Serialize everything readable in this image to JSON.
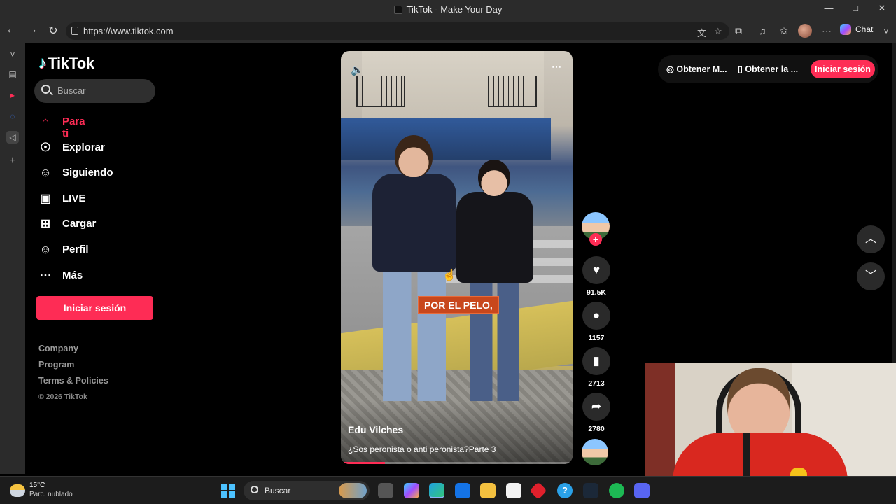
{
  "window": {
    "title": "TikTok - Make Your Day",
    "minimize": "—",
    "maximize": "□",
    "close": "✕"
  },
  "browser": {
    "url": "https://www.tiktok.com",
    "back": "←",
    "forward": "→",
    "reload": "↻",
    "chat_label": "Chat",
    "translate_icon": "文",
    "star_icon": "☆",
    "extensions_icon": "⧉",
    "media_icon": "♫",
    "favorites_icon": "✩",
    "more_icon": "⋯",
    "sidebar_collapse": "˅"
  },
  "edge_sidebar": {
    "items": [
      "˅",
      "▤",
      "▸",
      "◌",
      "◁",
      "+"
    ]
  },
  "tiktok": {
    "logo": "TikTok",
    "search_placeholder": "Buscar",
    "nav": [
      {
        "label": "Para ti",
        "icon": "home-icon",
        "glyph": "⌂",
        "active": true
      },
      {
        "label": "Explorar",
        "icon": "compass-icon",
        "glyph": "☉",
        "active": false
      },
      {
        "label": "Siguiendo",
        "icon": "following-icon",
        "glyph": "☺",
        "active": false
      },
      {
        "label": "LIVE",
        "icon": "live-icon",
        "glyph": "▣",
        "active": false
      },
      {
        "label": "Cargar",
        "icon": "upload-icon",
        "glyph": "⊞",
        "active": false
      },
      {
        "label": "Perfil",
        "icon": "profile-icon",
        "glyph": "☺",
        "active": false
      },
      {
        "label": "Más",
        "icon": "more-icon",
        "glyph": "⋯",
        "active": false
      }
    ],
    "login_button": "Iniciar sesión",
    "footer": [
      "Company",
      "Program",
      "Terms & Policies"
    ],
    "copyright": "© 2026 TikTok",
    "video": {
      "overlay_caption": "POR EL PELO,",
      "author": "Edu Vilches",
      "description": "¿Sos peronista o anti peronista?Parte 3",
      "progress": 0.19
    },
    "actions": {
      "likes": "91.5K",
      "comments": "1157",
      "saves": "2713",
      "shares": "2780"
    },
    "top_right": {
      "get_app_1": "Obtener M...",
      "get_app_2": "Obtener la ...",
      "login": "Iniciar sesión"
    }
  },
  "taskbar": {
    "temperature": "15°C",
    "weather_desc": "Parc. nublado",
    "search_placeholder": "Buscar"
  },
  "colors": {
    "accent": "#fe2c55",
    "background": "#000000",
    "browser_chrome": "#2b2b2b"
  }
}
